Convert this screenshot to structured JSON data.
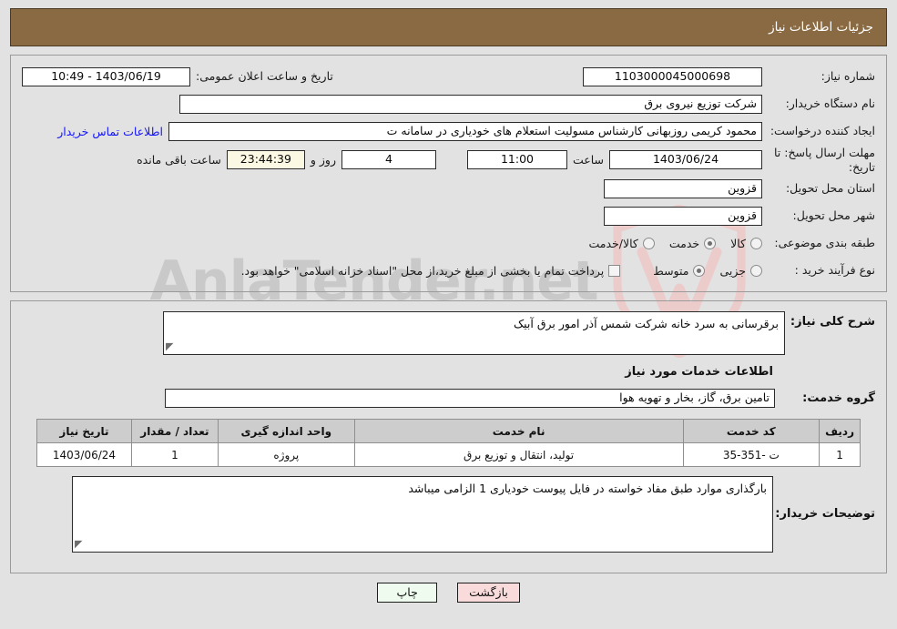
{
  "header": {
    "title": "جزئیات اطلاعات نیاز"
  },
  "form": {
    "need_number_label": "شماره نیاز:",
    "need_number_value": "1103000045000698",
    "public_announce_label": "تاریخ و ساعت اعلان عمومی:",
    "public_announce_value": "1403/06/19 - 10:49",
    "org_label": "نام دستگاه خریدار:",
    "org_value": "شرکت توزیع نیروی برق",
    "creator_label": "ایجاد کننده درخواست:",
    "creator_value": "محمود کریمی روزبهانی کارشناس  مسولیت استعلام های خودیاری در سامانه ت",
    "buyer_contact_link": "اطلاعات تماس خریدار",
    "deadline_label": "مهلت ارسال پاسخ: تا تاریخ:",
    "deadline_date": "1403/06/24",
    "deadline_hour_label": "ساعت",
    "deadline_hour": "11:00",
    "remaining_days": "4",
    "days_and_label": "روز و",
    "remaining_time": "23:44:39",
    "remaining_suffix": "ساعت باقی مانده",
    "province_label": "استان محل تحویل:",
    "province_value": "قزوین",
    "city_label": "شهر محل تحویل:",
    "city_value": "قزوین",
    "category_label": "طبقه بندی موضوعی:",
    "category_options": [
      {
        "label": "کالا",
        "selected": false
      },
      {
        "label": "خدمت",
        "selected": true
      },
      {
        "label": "کالا/خدمت",
        "selected": false
      }
    ],
    "process_label": "نوع فرآیند خرید :",
    "process_options": [
      {
        "label": "جزیی",
        "selected": false
      },
      {
        "label": "متوسط",
        "selected": true
      }
    ],
    "treasury_checkbox_text": "پرداخت تمام یا بخشی از مبلغ خرید،از محل \"اسناد خزانه اسلامی\" خواهد بود.",
    "treasury_checked": false
  },
  "description": {
    "need_summary_label": "شرح کلی نیاز:",
    "need_summary_value": "برقرسانی به سرد خانه شرکت شمس آذر امور برق آبیک",
    "services_section_title": "اطلاعات خدمات مورد نیاز",
    "service_group_label": "گروه خدمت:",
    "service_group_value": "تامین برق، گاز، بخار و تهویه هوا"
  },
  "table": {
    "columns": [
      "ردیف",
      "کد خدمت",
      "نام خدمت",
      "واحد اندازه گیری",
      "تعداد / مقدار",
      "تاریخ نیاز"
    ],
    "rows": [
      {
        "row": "1",
        "code": "ت -351-35",
        "name": "تولید، انتقال و توزیع برق",
        "unit": "پروژه",
        "qty": "1",
        "date": "1403/06/24"
      }
    ]
  },
  "notes": {
    "label": "توضیحات خریدار:",
    "value": "بارگذاری موارد طبق مفاد خواسته در فایل پیوست خودیاری 1 الزامی میباشد"
  },
  "footer": {
    "back_label": "بازگشت",
    "print_label": "چاپ"
  },
  "watermark": {
    "text": "AnlaTender.net"
  },
  "colors": {
    "header_bg": "#8a6a42",
    "page_bg": "#e2e2e2",
    "link": "#1414ff",
    "timer_bg": "#fbf8e3",
    "back_btn_bg": "#fadbdb",
    "print_btn_bg": "#eefbee",
    "table_header_bg": "#cdcdcd"
  }
}
